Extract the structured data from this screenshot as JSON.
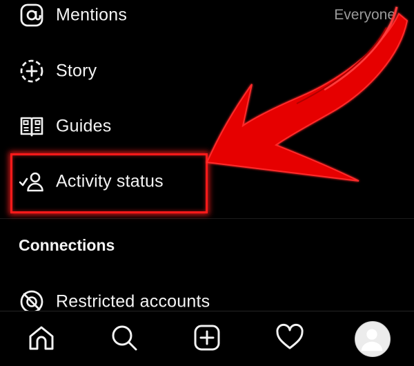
{
  "settings_list": {
    "items": [
      {
        "label": "Mentions",
        "value": "Everyone",
        "icon": "at-sign-icon"
      },
      {
        "label": "Story",
        "icon": "story-add-icon"
      },
      {
        "label": "Guides",
        "icon": "guides-book-icon"
      },
      {
        "label": "Activity status",
        "icon": "activity-status-icon"
      }
    ]
  },
  "connections": {
    "heading": "Connections",
    "items": [
      {
        "label": "Restricted accounts",
        "icon": "restricted-icon"
      }
    ]
  },
  "bottom_nav": {
    "items": [
      "home-icon",
      "search-icon",
      "create-icon",
      "heart-icon",
      "profile-avatar"
    ]
  },
  "colors": {
    "background": "#000000",
    "text": "#f4f4f4",
    "muted_text": "#9a9a9a",
    "highlight": "#ff1a1a"
  }
}
